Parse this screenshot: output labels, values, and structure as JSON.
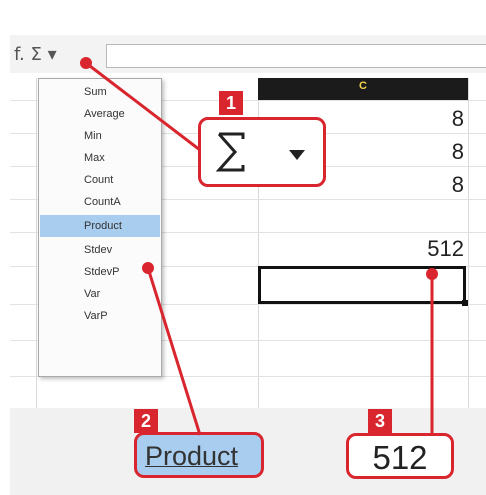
{
  "toolbar": {
    "formula_fragment": "f. Σ ▾",
    "formula_value": ""
  },
  "sheet": {
    "column_c": "C",
    "rows": [
      "8",
      "8",
      "8",
      "512",
      ""
    ]
  },
  "autosum_menu": {
    "items": [
      "Sum",
      "Average",
      "Min",
      "Max",
      "Count",
      "CountA",
      "Product",
      "Stdev",
      "StdevP",
      "Var",
      "VarP"
    ],
    "selected": "Product"
  },
  "callouts": {
    "step1": "1",
    "step2": "2",
    "step3": "3",
    "product_zoom": "Product",
    "result_zoom": "512"
  },
  "colors": {
    "accent_red": "#d9262e",
    "selection_blue": "#a8cdee"
  },
  "icons": [
    "sigma-icon",
    "dropdown-arrow-icon"
  ]
}
